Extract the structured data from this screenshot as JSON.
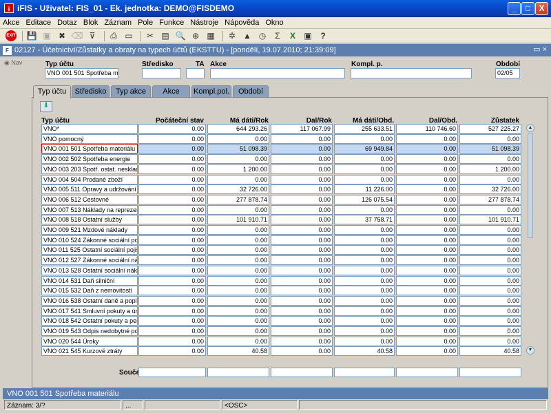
{
  "window": {
    "title": "iFIS - Uživatel: FIS_01 - Ek. jednotka: DEMO@FISDEMO",
    "app_badge": "i",
    "minimize": "_",
    "maximize": "□",
    "close": "X"
  },
  "menu": [
    "Akce",
    "Editace",
    "Dotaz",
    "Blok",
    "Záznam",
    "Pole",
    "Funkce",
    "Nástroje",
    "Nápověda",
    "Okno"
  ],
  "toolbar": {
    "exit_label": "EXIT",
    "icons": [
      "save-icon",
      "print-preview-icon",
      "delete-icon",
      "clear-icon",
      "filter-icon",
      "print-icon",
      "copy-icon",
      "cut-icon",
      "paste-icon",
      "find-icon",
      "zoom-icon",
      "calc-icon",
      "settings-icon",
      "chart-icon",
      "clock-icon",
      "sum-icon",
      "excel-icon",
      "export-icon",
      "help-icon"
    ],
    "glyphs": [
      "💾",
      "▣",
      "✖",
      "⌫",
      "⊽",
      "⎙",
      "▭",
      "✂",
      "▤",
      "🔍",
      "⊕",
      "▦",
      "✲",
      "▲",
      "◷",
      "Σ",
      "X",
      "▣",
      "?"
    ]
  },
  "form": {
    "title": "02127 - Účetnictví/Zůstatky a obraty na typech účtů (EKSTTU) - [pondělí, 19.07.2010; 21:39:09]",
    "icon_text": "F",
    "controls": "▭ ×",
    "nav_label": "Nav"
  },
  "header_fields": {
    "typ_uctu_label": "Typ účtu",
    "typ_uctu_value": "VNO 001 501 Spotřeba mat",
    "stredisko_label": "Středisko",
    "stredisko_value": "",
    "ta_label": "TA",
    "ta_value": "",
    "akce_label": "Akce",
    "akce_value": "",
    "kompl_label": "Kompl. p.",
    "kompl_value": "",
    "obdobi_label": "Období",
    "obdobi_value": "02/05"
  },
  "tabs": [
    "Typ účtu",
    "Středisko",
    "Typ akce",
    "Akce",
    "Kompl.pol.",
    "Období"
  ],
  "excel_icon": "⬇",
  "columns": [
    "Typ účtu",
    "Počáteční stav",
    "Má dáti/Rok",
    "Dal/Rok",
    "Má dáti/Obd.",
    "Dal/Obd.",
    "Zůstatek"
  ],
  "rows": [
    {
      "name": "VNO*",
      "v": [
        "0.00",
        "644 293.26",
        "117 067.99",
        "255 633.51",
        "110 746.60",
        "527 225.27"
      ]
    },
    {
      "name": "VNO pomocný",
      "v": [
        "0.00",
        "0.00",
        "0.00",
        "0.00",
        "0.00",
        "0.00"
      ]
    },
    {
      "name": "VNO 001 501 Spotřeba materiálu",
      "v": [
        "0.00",
        "51 098.39",
        "0.00",
        "69 949.84",
        "0.00",
        "51 098.39"
      ]
    },
    {
      "name": "VNO 002 502 Spotřeba energie",
      "v": [
        "0.00",
        "0.00",
        "0.00",
        "0.00",
        "0.00",
        "0.00"
      ]
    },
    {
      "name": "VNO 003 203 Spotř. ostat. neskladov",
      "v": [
        "0.00",
        "1 200.00",
        "0.00",
        "0.00",
        "0.00",
        "1 200.00"
      ]
    },
    {
      "name": "VNO 004 504 Prodané zboží",
      "v": [
        "0.00",
        "0.00",
        "0.00",
        "0.00",
        "0.00",
        "0.00"
      ]
    },
    {
      "name": "VNO 005 511 Opravy a udržování",
      "v": [
        "0.00",
        "32 726.00",
        "0.00",
        "11 226.00",
        "0.00",
        "32 726.00"
      ]
    },
    {
      "name": "VNO 006 512 Cestovné",
      "v": [
        "0.00",
        "277 878.74",
        "0.00",
        "126 075.54",
        "0.00",
        "277 878.74"
      ]
    },
    {
      "name": "VNO 007 513 Náklady na reprezente",
      "v": [
        "0.00",
        "0.00",
        "0.00",
        "0.00",
        "0.00",
        "0.00"
      ]
    },
    {
      "name": "VNO 008 518 Ostatní služby",
      "v": [
        "0.00",
        "101 910.71",
        "0.00",
        "37 758.71",
        "0.00",
        "101 910.71"
      ]
    },
    {
      "name": "VNO 009 521 Mzdové náklady",
      "v": [
        "0.00",
        "0.00",
        "0.00",
        "0.00",
        "0.00",
        "0.00"
      ]
    },
    {
      "name": "VNO 010 524 Zákonné sociální pojiš",
      "v": [
        "0.00",
        "0.00",
        "0.00",
        "0.00",
        "0.00",
        "0.00"
      ]
    },
    {
      "name": "VNO 011 525 Ostatní sociální pojiště",
      "v": [
        "0.00",
        "0.00",
        "0.00",
        "0.00",
        "0.00",
        "0.00"
      ]
    },
    {
      "name": "VNO 012 527 Zákonné sociální nákla",
      "v": [
        "0.00",
        "0.00",
        "0.00",
        "0.00",
        "0.00",
        "0.00"
      ]
    },
    {
      "name": "VNO 013 528 Ostatní sociální náklad",
      "v": [
        "0.00",
        "0.00",
        "0.00",
        "0.00",
        "0.00",
        "0.00"
      ]
    },
    {
      "name": "VNO 014 531 Daň silniční",
      "v": [
        "0.00",
        "0.00",
        "0.00",
        "0.00",
        "0.00",
        "0.00"
      ]
    },
    {
      "name": "VNO 015 532 Daň z nemovitostí",
      "v": [
        "0.00",
        "0.00",
        "0.00",
        "0.00",
        "0.00",
        "0.00"
      ]
    },
    {
      "name": "VNO 016 538 Ostatní daně a poplatk",
      "v": [
        "0.00",
        "0.00",
        "0.00",
        "0.00",
        "0.00",
        "0.00"
      ]
    },
    {
      "name": "VNO 017 541 Smluvní pokuty a úroky",
      "v": [
        "0.00",
        "0.00",
        "0.00",
        "0.00",
        "0.00",
        "0.00"
      ]
    },
    {
      "name": "VNO 018 542 Ostatní pokuty a penál",
      "v": [
        "0.00",
        "0.00",
        "0.00",
        "0.00",
        "0.00",
        "0.00"
      ]
    },
    {
      "name": "VNO 019 543 Odpis nedobytné pohle",
      "v": [
        "0.00",
        "0.00",
        "0.00",
        "0.00",
        "0.00",
        "0.00"
      ]
    },
    {
      "name": "VNO 020 544 Úroky",
      "v": [
        "0.00",
        "0.00",
        "0.00",
        "0.00",
        "0.00",
        "0.00"
      ]
    },
    {
      "name": "VNO 021 545 Kurzové ztráty",
      "v": [
        "0.00",
        "40.58",
        "0.00",
        "40.58",
        "0.00",
        "40.58"
      ]
    }
  ],
  "selected_row": 2,
  "scroll": {
    "up": "▲",
    "down": "▼",
    "position": 0.0,
    "visible_fraction": 0.49
  },
  "sum_label": "Součet",
  "sum_values": [
    "",
    "",
    "",
    "",
    "",
    ""
  ],
  "status": {
    "line1": "VNO 001 501 Spotřeba materiálu",
    "record": "Záznam: 3/?",
    "seg2": "...",
    "osc": "<OSC>"
  }
}
